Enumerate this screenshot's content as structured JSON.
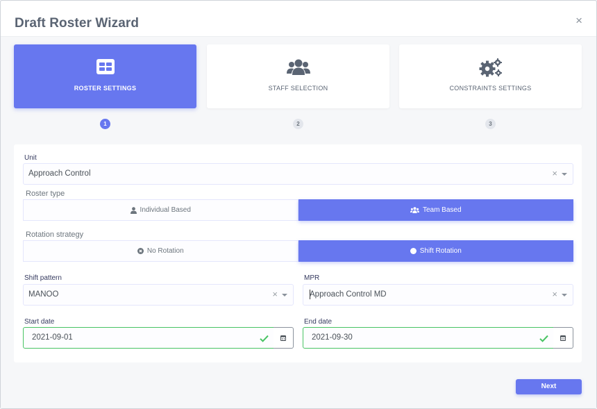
{
  "dialog": {
    "title": "Draft Roster Wizard",
    "close": "×"
  },
  "steps": [
    {
      "label": "ROSTER SETTINGS",
      "number": "1",
      "icon": "table-icon",
      "active": true
    },
    {
      "label": "STAFF SELECTION",
      "number": "2",
      "icon": "users-icon",
      "active": false
    },
    {
      "label": "CONSTRAINTS SETTINGS",
      "number": "3",
      "icon": "cogs-icon",
      "active": false
    }
  ],
  "form": {
    "unit": {
      "label": "Unit",
      "value": "Approach Control"
    },
    "roster_type": {
      "label": "Roster type",
      "options": [
        "Individual Based",
        "Team Based"
      ],
      "selected": "Team Based"
    },
    "rotation": {
      "label": "Rotation strategy",
      "options": [
        "No Rotation",
        "Shift Rotation"
      ],
      "selected": "Shift Rotation"
    },
    "shift_pattern": {
      "label": "Shift pattern",
      "value": "MANOO"
    },
    "mpr": {
      "label": "MPR",
      "value": "Approach Control MD"
    },
    "start_date": {
      "label": "Start date",
      "value": "2021-09-01"
    },
    "end_date": {
      "label": "End date",
      "value": "2021-09-30"
    }
  },
  "footer": {
    "next_label": "Next"
  },
  "colors": {
    "primary": "#6777ef",
    "success": "#47c363"
  }
}
